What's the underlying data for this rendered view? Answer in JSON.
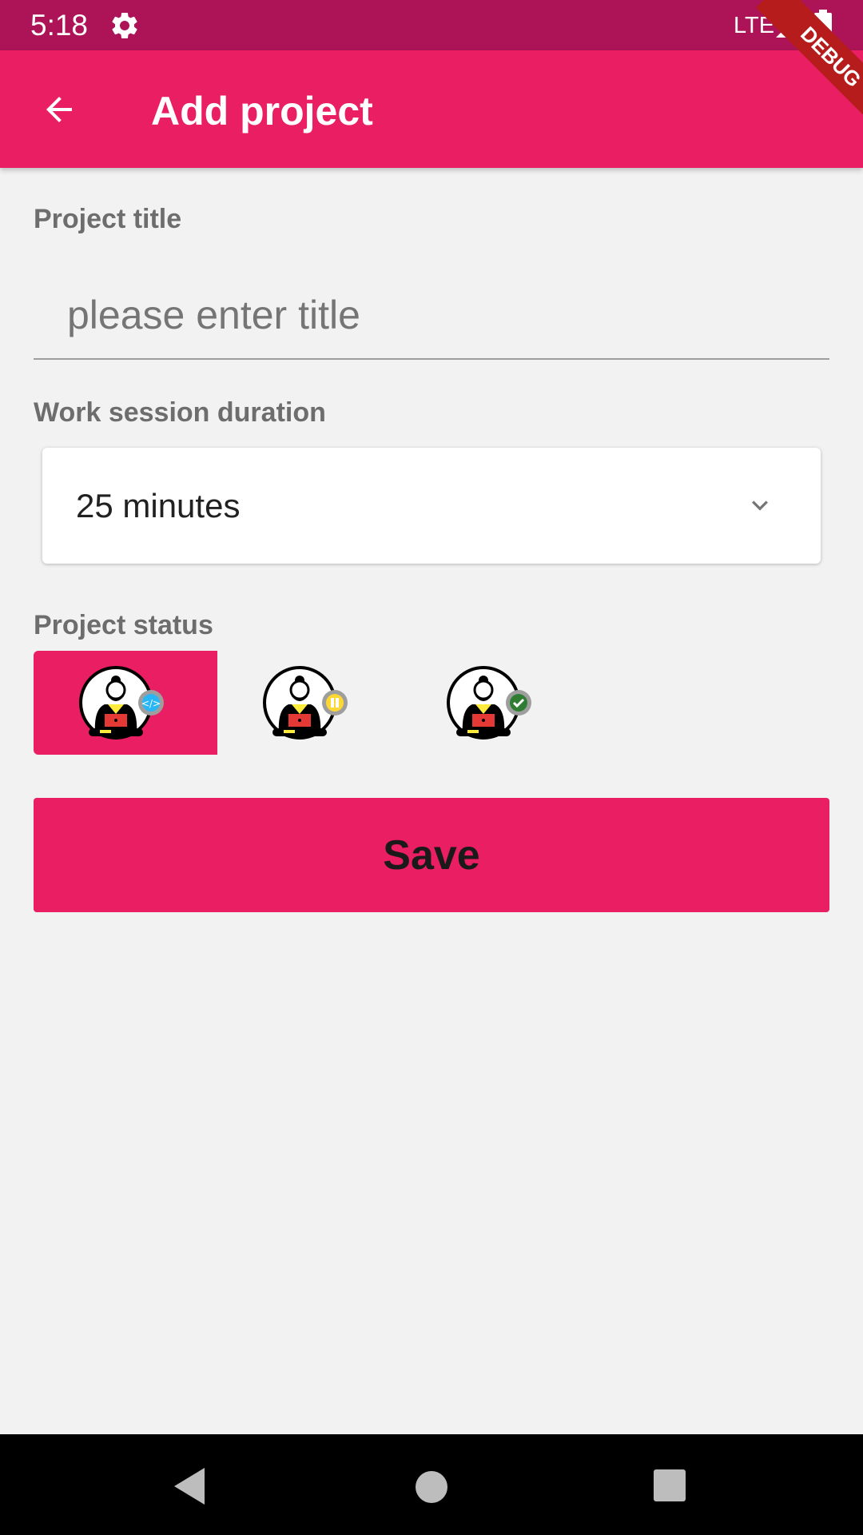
{
  "status_bar": {
    "time": "5:18",
    "network": "LTE",
    "icons": [
      "gear-icon",
      "signal-icon",
      "battery-icon"
    ]
  },
  "app_bar": {
    "title": "Add project",
    "back_icon": "arrow-back-icon",
    "debug_banner": "DEBUG"
  },
  "form": {
    "title_label": "Project title",
    "title_placeholder": "please enter title",
    "title_value": "",
    "duration_label": "Work session duration",
    "duration_value": "25 minutes",
    "status_label": "Project status",
    "status_options": [
      {
        "name": "in-progress",
        "badge": "code-icon",
        "selected": true
      },
      {
        "name": "paused",
        "badge": "pause-icon",
        "selected": false
      },
      {
        "name": "completed",
        "badge": "check-icon",
        "selected": false
      }
    ],
    "save_label": "Save"
  },
  "colors": {
    "primary": "#e91e63",
    "status_bar": "#ad1457",
    "background": "#f2f2f2",
    "label_text": "#6d6d6d"
  },
  "nav_bar": {
    "icons": [
      "nav-back-icon",
      "nav-home-icon",
      "nav-recents-icon"
    ]
  }
}
